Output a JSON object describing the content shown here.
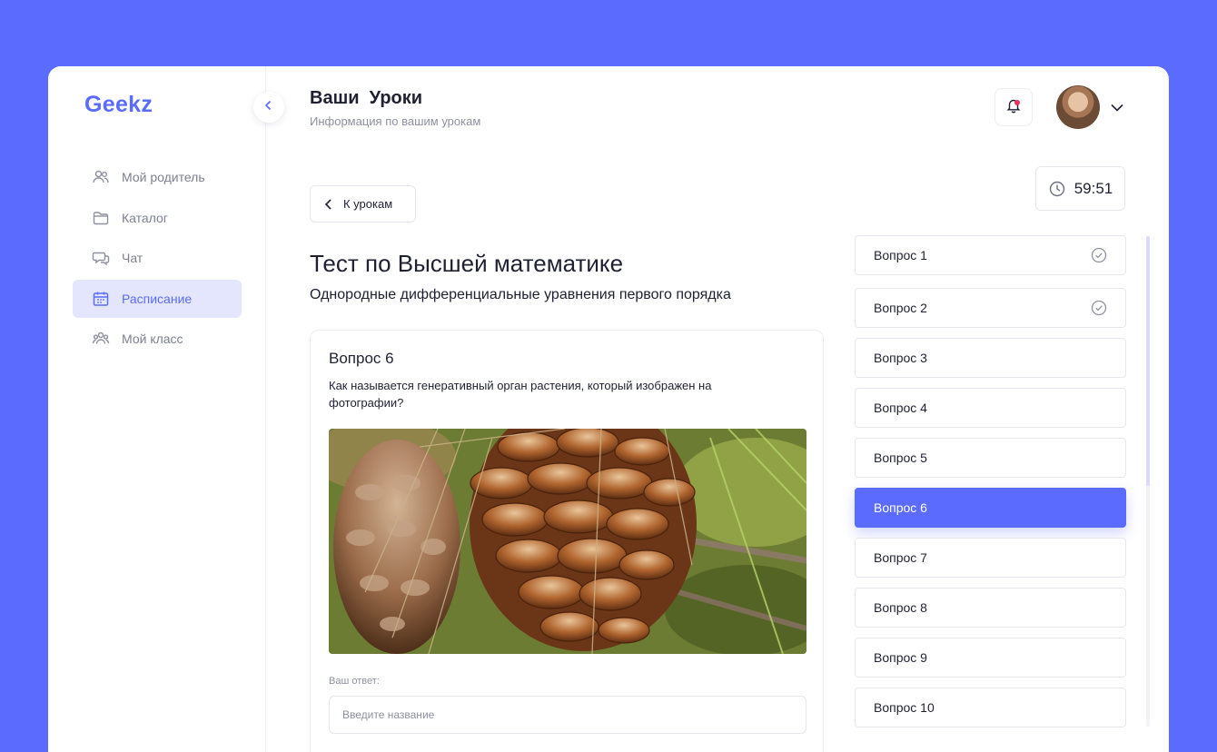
{
  "app": {
    "logo": "Geekz"
  },
  "sidebar": {
    "items": [
      {
        "label": "Мой родитель",
        "icon": "users-icon",
        "active": false
      },
      {
        "label": "Каталог",
        "icon": "folder-icon",
        "active": false
      },
      {
        "label": "Чат",
        "icon": "chat-icon",
        "active": false
      },
      {
        "label": "Расписание",
        "icon": "calendar-icon",
        "active": true
      },
      {
        "label": "Мой класс",
        "icon": "class-icon",
        "active": false
      }
    ]
  },
  "header": {
    "title_prefix": "Ваши",
    "title_bold": "Уроки",
    "subtitle": "Информация по вашим урокам"
  },
  "toolbar": {
    "back_label": "К урокам",
    "timer": "59:51"
  },
  "test": {
    "title": "Тест по Высшей математике",
    "subtitle": "Однородные дифференциальные уравнения первого порядка"
  },
  "question": {
    "title": "Вопрос 6",
    "text": "Как называется генеративный орган растения, который изображен на фотографии?",
    "answer_label": "Ваш ответ:",
    "answer_value": "",
    "answer_placeholder": "Введите название"
  },
  "question_list": [
    {
      "label": "Вопрос 1",
      "done": true
    },
    {
      "label": "Вопрос 2",
      "done": true
    },
    {
      "label": "Вопрос 3",
      "done": false
    },
    {
      "label": "Вопрос 4",
      "done": false
    },
    {
      "label": "Вопрос 5",
      "done": false
    },
    {
      "label": "Вопрос 6",
      "done": false,
      "active": true
    },
    {
      "label": "Вопрос 7",
      "done": false
    },
    {
      "label": "Вопрос 8",
      "done": false
    },
    {
      "label": "Вопрос 9",
      "done": false
    },
    {
      "label": "Вопрос 10",
      "done": false
    }
  ],
  "colors": {
    "accent": "#5B6BFE",
    "accent_light": "#E4E6FD",
    "notification": "#E9335C"
  }
}
